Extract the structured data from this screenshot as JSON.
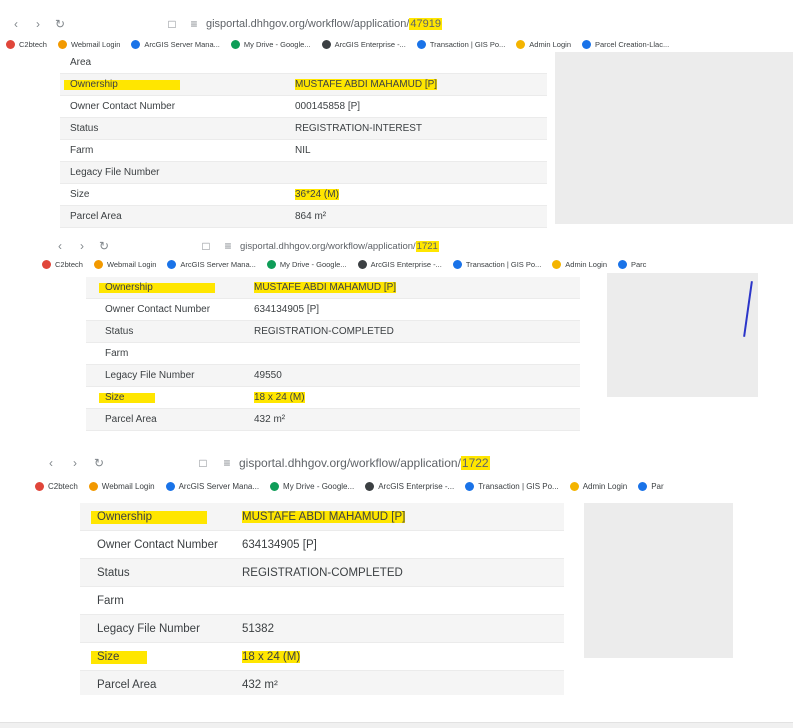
{
  "bookmarks": [
    "C2btech",
    "Webmail Login",
    "ArcGIS Server Mana...",
    "My Drive - Google...",
    "ArcGIS Enterprise -...",
    "Transaction | GIS Po...",
    "Admin Login",
    "Parcel Creation-Llac..."
  ],
  "bookmarks_short": [
    "C2btech",
    "Webmail Login",
    "ArcGIS Server Mana...",
    "My Drive - Google...",
    "ArcGIS Enterprise -...",
    "Transaction | GIS Po...",
    "Admin Login",
    "Parc"
  ],
  "bookmarks_short2": [
    "C2btech",
    "Webmail Login",
    "ArcGIS Server Mana...",
    "My Drive - Google...",
    "ArcGIS Enterprise -...",
    "Transaction | GIS Po...",
    "Admin Login",
    "Par"
  ],
  "shot1": {
    "url_base": "gisportal.dhhgov.org/workflow/application/",
    "url_id": "47919",
    "rows": [
      {
        "label": "Area",
        "value": ""
      },
      {
        "label": "Ownership",
        "value": "MUSTAFE ABDI MAHAMUD [P]"
      },
      {
        "label": "Owner Contact Number",
        "value": "000145858 [P]"
      },
      {
        "label": "Status",
        "value": "REGISTRATION-INTEREST"
      },
      {
        "label": "Farm",
        "value": "NIL"
      },
      {
        "label": "Legacy File Number",
        "value": ""
      },
      {
        "label": "Size",
        "value": "36*24 (M)"
      },
      {
        "label": "Parcel Area",
        "value": "864 m²"
      }
    ]
  },
  "shot2": {
    "url_base": "gisportal.dhhgov.org/workflow/application/",
    "url_id": "1721",
    "rows": [
      {
        "label": "Ownership",
        "value": "MUSTAFE ABDI MAHAMUD [P]"
      },
      {
        "label": "Owner Contact Number",
        "value": "634134905 [P]"
      },
      {
        "label": "Status",
        "value": "REGISTRATION-COMPLETED"
      },
      {
        "label": "Farm",
        "value": ""
      },
      {
        "label": "Legacy File Number",
        "value": "49550"
      },
      {
        "label": "Size",
        "value": "18 x 24 (M)"
      },
      {
        "label": "Parcel Area",
        "value": "432 m²"
      }
    ]
  },
  "shot3": {
    "url_base": "gisportal.dhhgov.org/workflow/application/",
    "url_id": "1722",
    "rows": [
      {
        "label": "Ownership",
        "value": "MUSTAFE ABDI MAHAMUD [P]"
      },
      {
        "label": "Owner Contact Number",
        "value": "634134905 [P]"
      },
      {
        "label": "Status",
        "value": "REGISTRATION-COMPLETED"
      },
      {
        "label": "Farm",
        "value": ""
      },
      {
        "label": "Legacy File Number",
        "value": "51382"
      },
      {
        "label": "Size",
        "value": "18 x 24 (M)"
      },
      {
        "label": "Parcel Area",
        "value": "432 m²"
      }
    ]
  },
  "colors": {
    "highlight": "#ffe600",
    "blue_edge": "#2b35c9"
  },
  "icons": [
    "back-icon",
    "forward-icon",
    "reload-icon",
    "bookmark-icon",
    "site-info-icon"
  ]
}
